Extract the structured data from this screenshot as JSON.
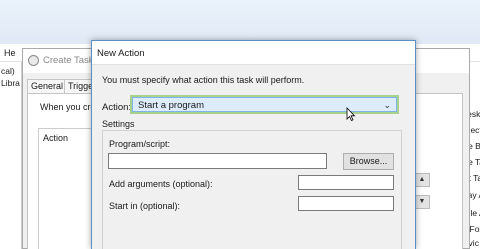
{
  "background": {
    "menu_fragment": "He",
    "left_column_rows": [
      "cal)",
      "Libra"
    ],
    "right_column_rows": [
      "Deskto",
      "nnect",
      "ate Ba",
      "ate Ta",
      "ort Tas",
      "play A",
      "able A",
      "w Fol",
      "ervic"
    ]
  },
  "create_task": {
    "title": "Create Task",
    "tabs": [
      "General",
      "Trigge"
    ],
    "hint_text": "When you cre",
    "actions_header": "Action",
    "up_arrow": "▲",
    "down_arrow": "▼"
  },
  "dialog": {
    "title": "New Action",
    "message": "You must specify what action this task will perform.",
    "action_label": "Action:",
    "action_value": "Start a program",
    "action_chevron": "⌄",
    "settings_label": "Settings",
    "program_label": "Program/script:",
    "program_value": "",
    "browse_label": "Browse...",
    "arguments_label": "Add arguments (optional):",
    "arguments_value": "",
    "start_in_label": "Start in (optional):",
    "start_in_value": ""
  }
}
